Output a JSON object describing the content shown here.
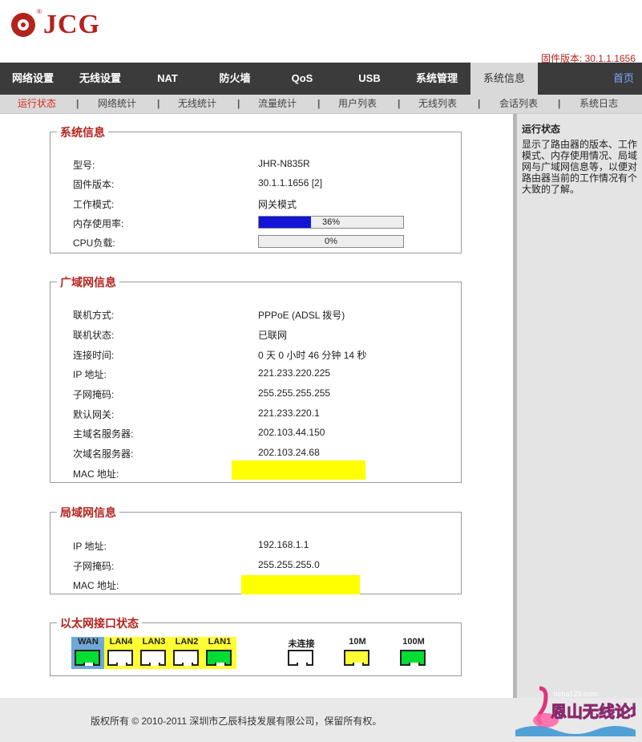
{
  "brand": {
    "name": "JCG",
    "reg_mark": "®"
  },
  "firmware_top": "固件版本: 30.1.1.1656",
  "main_nav": [
    "网络设置",
    "无线设置",
    "NAT",
    "防火墙",
    "QoS",
    "USB",
    "系统管理",
    "系统信息"
  ],
  "home_link": "首页",
  "sub_nav": [
    "运行状态",
    "网络统计",
    "无线统计",
    "流量统计",
    "用户列表",
    "无线列表",
    "会话列表",
    "系统日志"
  ],
  "sub_sep": "|",
  "system_info": {
    "title": "系统信息",
    "model_label": "型号:",
    "model": "JHR-N835R",
    "firmware_label": "固件版本:",
    "firmware": "30.1.1.1656 [2]",
    "mode_label": "工作模式:",
    "mode": "网关模式",
    "mem_label": "内存使用率:",
    "mem_pct_text": "36%",
    "mem_pct": 36,
    "cpu_label": "CPU负载:",
    "cpu_pct_text": "0%",
    "cpu_pct": 0
  },
  "wan_info": {
    "title": "广域网信息",
    "conn_type_label": "联机方式:",
    "conn_type": "PPPoE (ADSL 拨号)",
    "status_label": "联机状态:",
    "status": "已联网",
    "uptime_label": "连接时间:",
    "uptime": "0 天 0 小时 46 分钟 14 秒",
    "ip_label": "IP 地址:",
    "ip": "221.233.220.225",
    "mask_label": "子网掩码:",
    "mask": "255.255.255.255",
    "gateway_label": "默认网关:",
    "gateway": "221.233.220.1",
    "dns1_label": "主域名服务器:",
    "dns1": "202.103.44.150",
    "dns2_label": "次域名服务器:",
    "dns2": "202.103.24.68",
    "mac_label": "MAC 地址:"
  },
  "lan_info": {
    "title": "局域网信息",
    "ip_label": "IP 地址:",
    "ip": "192.168.1.1",
    "mask_label": "子网掩码:",
    "mask": "255.255.255.0",
    "mac_label": "MAC 地址:"
  },
  "eth": {
    "title": "以太网接口状态",
    "ports": [
      {
        "label": "WAN",
        "state": "100M"
      },
      {
        "label": "LAN4",
        "state": "未连接"
      },
      {
        "label": "LAN3",
        "state": "未连接"
      },
      {
        "label": "LAN2",
        "state": "未连接"
      },
      {
        "label": "LAN1",
        "state": "100M"
      }
    ],
    "legend": [
      {
        "label": "未连接",
        "color": "#ffffff"
      },
      {
        "label": "10M",
        "color": "#ffff33"
      },
      {
        "label": "100M",
        "color": "#00dd33"
      }
    ],
    "colors": {
      "wan_bg": "#6fa8d6",
      "lan_bg": "#ffff33"
    }
  },
  "sidebar": {
    "title": "运行状态",
    "text": "显示了路由器的版本、工作模式、内存使用情况、局域网与广域网信息等，以便对路由器当前的工作情况有个大致的了解。"
  },
  "footer": "版权所有 © 2010-2011 深圳市乙辰科技发展有限公司，保留所有权。",
  "watermark": {
    "site": "tieba123.com",
    "text": "恩山无线论坛"
  }
}
